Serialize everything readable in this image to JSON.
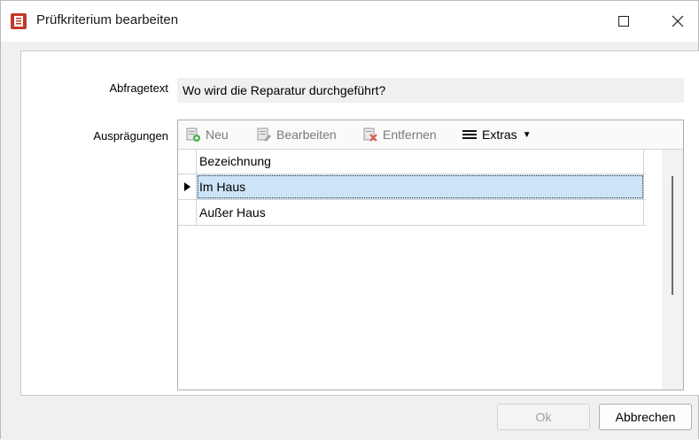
{
  "window": {
    "title": "Prüfkriterium bearbeiten"
  },
  "form": {
    "query_label": "Abfragetext",
    "query_value": "Wo wird die Reparatur durchgeführt?",
    "values_label": "Ausprägungen"
  },
  "toolbar": {
    "new_label": "Neu",
    "edit_label": "Bearbeiten",
    "remove_label": "Entfernen",
    "extras_label": "Extras"
  },
  "grid": {
    "header": "Bezeichnung",
    "rows": [
      {
        "label": "Im Haus",
        "selected": true
      },
      {
        "label": "Außer Haus",
        "selected": false
      }
    ]
  },
  "footer": {
    "ok_label": "Ok",
    "cancel_label": "Abbrechen"
  },
  "colors": {
    "selection": "#cce4f7",
    "window_bg": "#f0f0f0"
  },
  "icons": [
    "app-icon",
    "maximize-icon",
    "close-icon",
    "new-icon",
    "edit-icon",
    "remove-icon",
    "menu-icon",
    "row-pointer-icon"
  ]
}
